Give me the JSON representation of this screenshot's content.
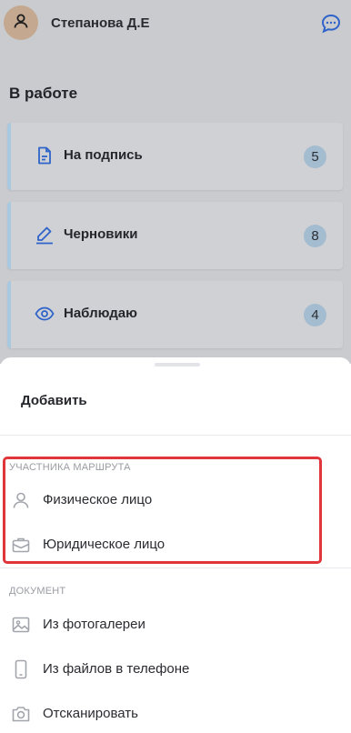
{
  "header": {
    "user_name": "Степанова Д.Е"
  },
  "section": {
    "title": "В работе"
  },
  "cards": [
    {
      "label": "На подпись",
      "count": "5",
      "icon": "document-icon"
    },
    {
      "label": "Черновики",
      "count": "8",
      "icon": "pencil-icon"
    },
    {
      "label": "Наблюдаю",
      "count": "4",
      "icon": "eye-icon"
    }
  ],
  "sheet": {
    "title": "Добавить",
    "participants": {
      "label": "УЧАСТНИКА МАРШРУТА",
      "items": [
        {
          "label": "Физическое лицо",
          "icon": "person-icon"
        },
        {
          "label": "Юридическое лицо",
          "icon": "briefcase-icon"
        }
      ]
    },
    "document": {
      "label": "ДОКУМЕНТ",
      "items": [
        {
          "label": "Из фотогалереи",
          "icon": "image-icon"
        },
        {
          "label": "Из файлов в телефоне",
          "icon": "phone-icon"
        },
        {
          "label": "Отсканировать",
          "icon": "camera-icon"
        }
      ]
    }
  },
  "colors": {
    "highlight": "#e0353b",
    "badge": "#a4bcd0",
    "accent": "#2f63c9"
  }
}
